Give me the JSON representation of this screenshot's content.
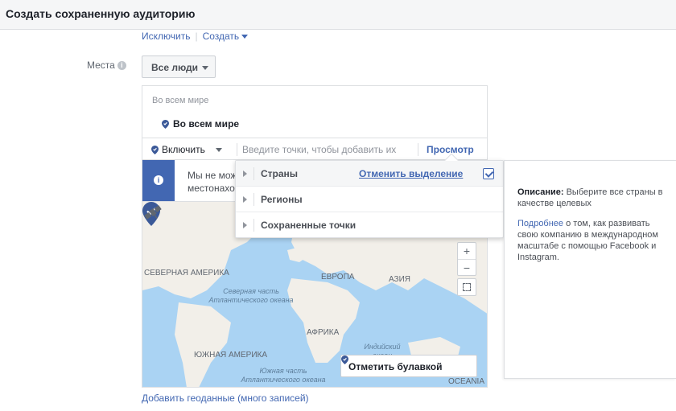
{
  "header": {
    "title": "Создать сохраненную аудиторию"
  },
  "top_links": {
    "exclude": "Исключить",
    "create": "Создать"
  },
  "places": {
    "label": "Места",
    "info_icon": "info-icon",
    "audience_select": "Все люди"
  },
  "locations": {
    "group_title": "Во всем мире",
    "selected_item": "Во всем мире",
    "include_label": "Включить",
    "search_placeholder": "Введите точки, чтобы добавить их",
    "view_button": "Просмотр"
  },
  "notice": {
    "text_line1": "Мы не мож",
    "text_line2": "местонахо"
  },
  "dropdown": {
    "rows": [
      {
        "label": "Страны",
        "deselect": "Отменить выделение",
        "checked": true
      },
      {
        "label": "Регионы"
      },
      {
        "label": "Сохраненные точки"
      }
    ]
  },
  "description": {
    "title": "Описание:",
    "body": " Выберите все страны в качестве целевых",
    "more_link": "Подробнее",
    "more_text": " о том, как развивать свою компанию в международном масштабе с помощью Facebook и Instagram."
  },
  "map": {
    "labels": {
      "north_america": "СЕВЕРНАЯ АМЕРИКА",
      "europe": "ЕВРОПА",
      "asia": "АЗИЯ",
      "africa": "АФРИКА",
      "south_america": "ЮЖНАЯ АМЕРИКА",
      "oceania": "OCEANIA",
      "north_atlantic": "Северная часть Атлантического океана",
      "south_atlantic": "Южная часть Атлантического океана",
      "indian_ocean": "Индийский океан"
    },
    "zoom_in": "+",
    "zoom_out": "−",
    "drop_pin_button": "Отметить булавкой",
    "colors": {
      "water": "#aad3f3",
      "land": "#f2efe9",
      "pin": "#3b5998"
    }
  },
  "footer": {
    "add_geo_link": "Добавить геоданные (много записей)"
  }
}
